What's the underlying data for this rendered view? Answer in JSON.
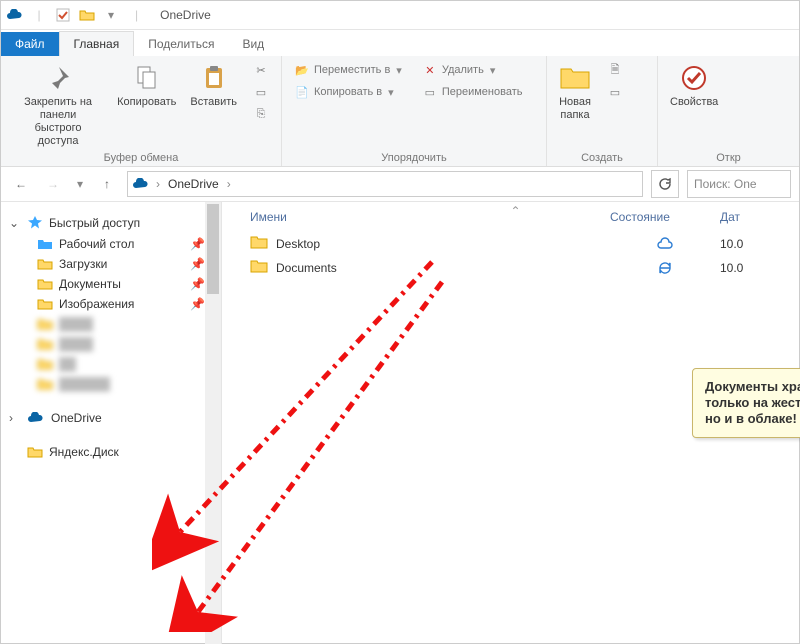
{
  "title": "OneDrive",
  "tabs": {
    "file": "Файл",
    "home": "Главная",
    "share": "Поделиться",
    "view": "Вид"
  },
  "ribbon": {
    "clipboard": {
      "pin": "Закрепить на панели\nбыстрого доступа",
      "copy": "Копировать",
      "paste": "Вставить",
      "label": "Буфер обмена"
    },
    "organize": {
      "moveTo": "Переместить в",
      "copyTo": "Копировать в",
      "delete": "Удалить",
      "rename": "Переименовать",
      "label": "Упорядочить"
    },
    "new": {
      "newFolder": "Новая\nпапка",
      "label": "Создать"
    },
    "open": {
      "properties": "Свойства",
      "label": "Откр"
    }
  },
  "nav": {
    "location": "OneDrive",
    "searchPlaceholder": "Поиск: One"
  },
  "tree": {
    "quickAccess": "Быстрый доступ",
    "items": [
      {
        "label": "Рабочий стол",
        "pin": true,
        "iconColor": "#3aa7ff"
      },
      {
        "label": "Загрузки",
        "pin": true,
        "iconColor": "#ffb400"
      },
      {
        "label": "Документы",
        "pin": true,
        "iconColor": "#ffb400"
      },
      {
        "label": "Изображения",
        "pin": true,
        "iconColor": "#ffb400"
      }
    ],
    "onedrive": "OneDrive",
    "yadisk": "Яндекс.Диск"
  },
  "columns": {
    "name": "Имени",
    "state": "Состояние",
    "date": "Дат"
  },
  "files": [
    {
      "name": "Desktop",
      "state": "cloud",
      "date": "10.0"
    },
    {
      "name": "Documents",
      "state": "sync",
      "date": "10.0"
    }
  ],
  "callout": "Документы хранятся не только на жестком диске ПК, но и в облаке!"
}
